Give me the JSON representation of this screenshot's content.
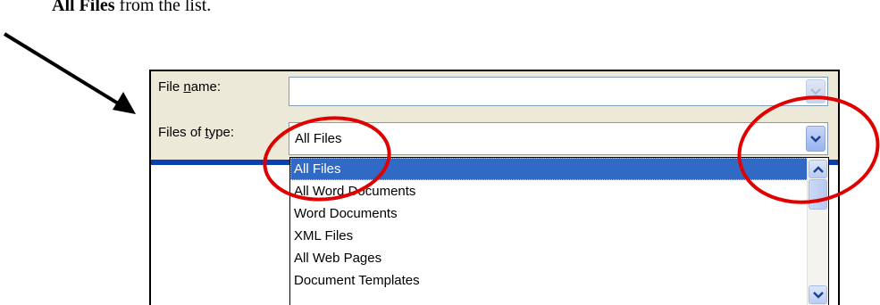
{
  "instruction": {
    "bold": "All Files",
    "rest": " from the list."
  },
  "dialog": {
    "file_name_label_pre": "File ",
    "file_name_label_key": "n",
    "file_name_label_post": "ame:",
    "file_name_value": "",
    "files_of_type_label_pre": "Files of ",
    "files_of_type_label_key": "t",
    "files_of_type_label_post": "ype:",
    "files_of_type_value": "All Files"
  },
  "dropdown_list": {
    "items": [
      "All Files",
      "All Word Documents",
      "Word Documents",
      "XML Files",
      "All Web Pages",
      "Document Templates"
    ],
    "selected_index": 0
  },
  "icons": {
    "dropdown_arrow": "chevron-down-icon",
    "scroll_up": "chevron-up-icon",
    "scroll_down": "chevron-down-icon"
  },
  "colors": {
    "selection": "#316ac5",
    "annotation": "#e00000",
    "dialog_bg": "#ece9d8",
    "blue_band": "#0a3fb4"
  }
}
